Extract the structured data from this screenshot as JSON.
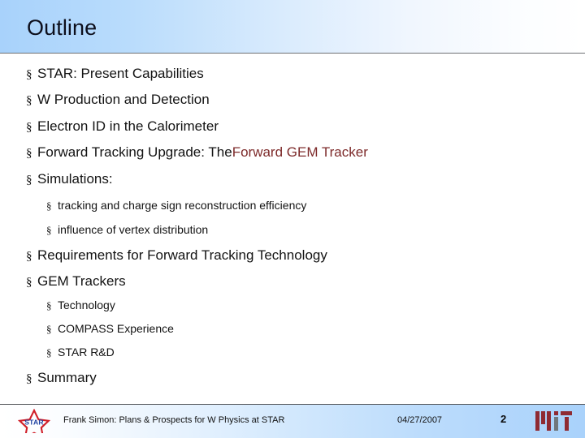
{
  "slide": {
    "title": "Outline",
    "page_number": "2"
  },
  "colors": {
    "header_gradient_start": "#a8d2fb",
    "header_gradient_end": "#ffffff",
    "footer_gradient_start": "#ffffff",
    "footer_gradient_end": "#a9d2fb",
    "text": "#131313",
    "accent_red": "#7d2a2a",
    "star_logo_red": "#d01e28",
    "star_logo_blue": "#1b3fa0",
    "mit_logo_red": "#8f2a32",
    "mit_logo_gray": "#70777c",
    "rule": "#6e7074"
  },
  "outline": {
    "bullet_glyph": "§",
    "items": [
      {
        "level": 1,
        "text": "STAR: Present Capabilities"
      },
      {
        "level": 1,
        "text": "W Production and Detection"
      },
      {
        "level": 1,
        "text": "Electron ID in the Calorimeter"
      },
      {
        "level": 1,
        "text": "Forward Tracking Upgrade: The ",
        "text_accent": "Forward GEM Tracker"
      },
      {
        "level": 1,
        "text": "Simulations:"
      },
      {
        "level": 2,
        "text": "tracking and charge sign reconstruction efficiency"
      },
      {
        "level": 2,
        "text": "influence of vertex distribution"
      },
      {
        "level": 1,
        "text": "Requirements for Forward Tracking Technology"
      },
      {
        "level": 1,
        "text": "GEM Trackers"
      },
      {
        "level": 2,
        "text": "Technology"
      },
      {
        "level": 2,
        "text": "COMPASS Experience"
      },
      {
        "level": 2,
        "text": "STAR R&D"
      },
      {
        "level": 1,
        "text": "Summary"
      }
    ]
  },
  "footer": {
    "credit": "Frank Simon: Plans & Prospects for W Physics at STAR",
    "date": "04/27/2007",
    "page_number": "2",
    "star_logo_label": "STAR",
    "mit_logo_label": "MIT"
  }
}
